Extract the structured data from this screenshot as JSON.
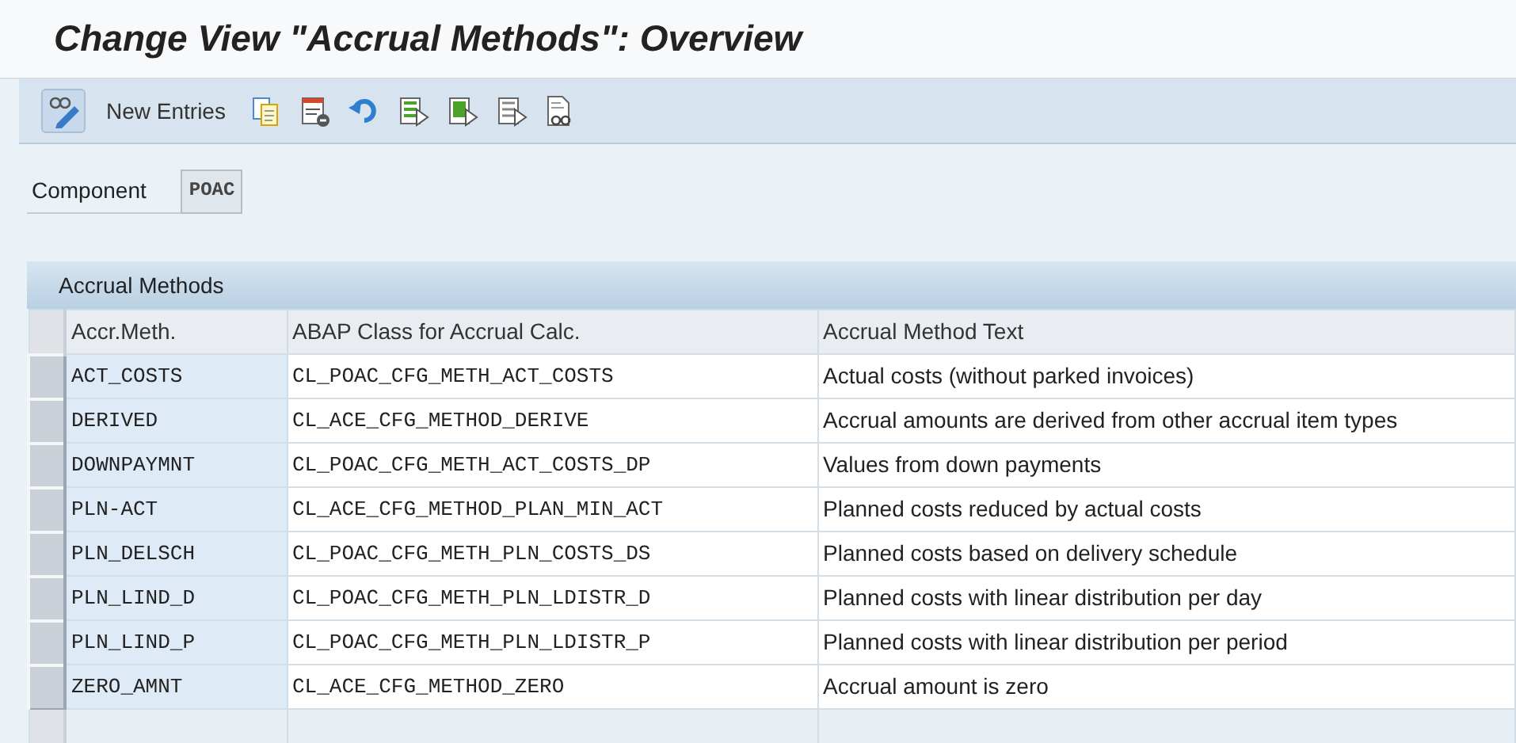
{
  "window": {
    "title": "Change View \"Accrual Methods\": Overview"
  },
  "toolbar": {
    "buttons": [
      {
        "kind": "icon"
      },
      {
        "kind": "text",
        "label": "New Entries"
      },
      {
        "kind": "icon"
      },
      {
        "kind": "icon"
      },
      {
        "kind": "icon"
      },
      {
        "kind": "icon"
      },
      {
        "kind": "icon"
      },
      {
        "kind": "icon"
      },
      {
        "kind": "icon"
      }
    ]
  },
  "component": {
    "label": "Component",
    "value": "POAC"
  },
  "table": {
    "title": "Accrual Methods",
    "columns": [
      "Accr.Meth.",
      "ABAP Class for Accrual Calc.",
      "Accrual Method Text"
    ],
    "rows": [
      [
        "ACT_COSTS",
        "CL_POAC_CFG_METH_ACT_COSTS",
        "Actual costs (without parked invoices)"
      ],
      [
        "DERIVED",
        "CL_ACE_CFG_METHOD_DERIVE",
        "Accrual amounts are derived from other accrual item types"
      ],
      [
        "DOWNPAYMNT",
        "CL_POAC_CFG_METH_ACT_COSTS_DP",
        "Values from down payments"
      ],
      [
        "PLN-ACT",
        "CL_ACE_CFG_METHOD_PLAN_MIN_ACT",
        "Planned costs reduced by actual costs"
      ],
      [
        "PLN_DELSCH",
        "CL_POAC_CFG_METH_PLN_COSTS_DS",
        "Planned costs based on delivery schedule"
      ],
      [
        "PLN_LIND_D",
        "CL_POAC_CFG_METH_PLN_LDISTR_D",
        "Planned costs with linear distribution per day"
      ],
      [
        "PLN_LIND_P",
        "CL_POAC_CFG_METH_PLN_LDISTR_P",
        "Planned costs with linear distribution per period"
      ],
      [
        "ZERO_AMNT",
        "CL_ACE_CFG_METHOD_ZERO",
        "Accrual amount is zero"
      ]
    ]
  }
}
